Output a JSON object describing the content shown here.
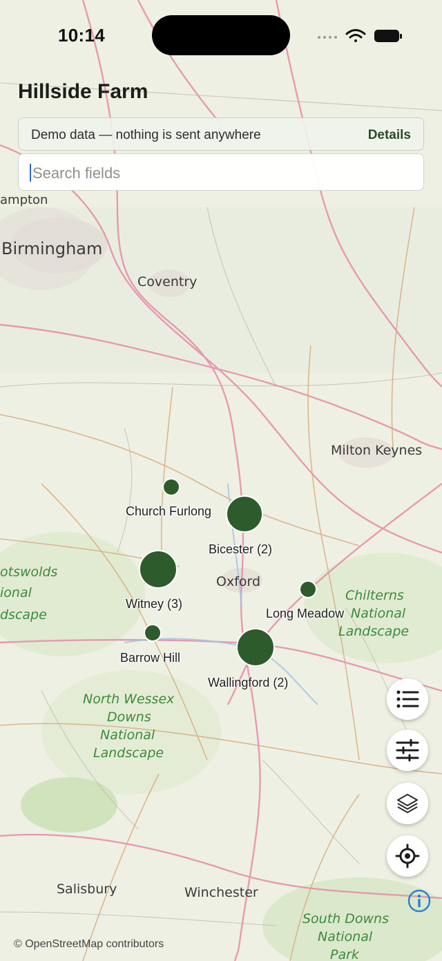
{
  "status_bar": {
    "time": "10:14"
  },
  "header": {
    "title": "Hillside Farm"
  },
  "notice": {
    "text": "Demo data — nothing is sent anywhere",
    "link": "Details"
  },
  "search": {
    "placeholder": "Search fields"
  },
  "map": {
    "attribution": "© OpenStreetMap contributors",
    "place_labels": [
      "Birmingham",
      "Coventry",
      "Oxford",
      "Milton Keynes",
      "Salisbury",
      "Winchester",
      "ampton",
      "Chilterns",
      "National",
      "Landscape",
      "North Wessex",
      "Downs",
      "National",
      "Landscape",
      "otswolds",
      "ional",
      "dscape",
      "South Downs",
      "National",
      "Park"
    ]
  },
  "markers": [
    {
      "label": "Church Furlong",
      "count": 1
    },
    {
      "label": "Bicester (2)",
      "count": 2
    },
    {
      "label": "Witney (3)",
      "count": 3
    },
    {
      "label": "Long Meadow",
      "count": 1
    },
    {
      "label": "Barrow Hill",
      "count": 1
    },
    {
      "label": "Wallingford (2)",
      "count": 2
    }
  ],
  "controls": {
    "icons": [
      "list-icon",
      "sliders-icon",
      "layers-icon",
      "locate-icon",
      "info-icon"
    ]
  },
  "colors": {
    "marker": "#2e5b2b",
    "accent_text": "#2b4a2a",
    "caret": "#2b63d9"
  }
}
